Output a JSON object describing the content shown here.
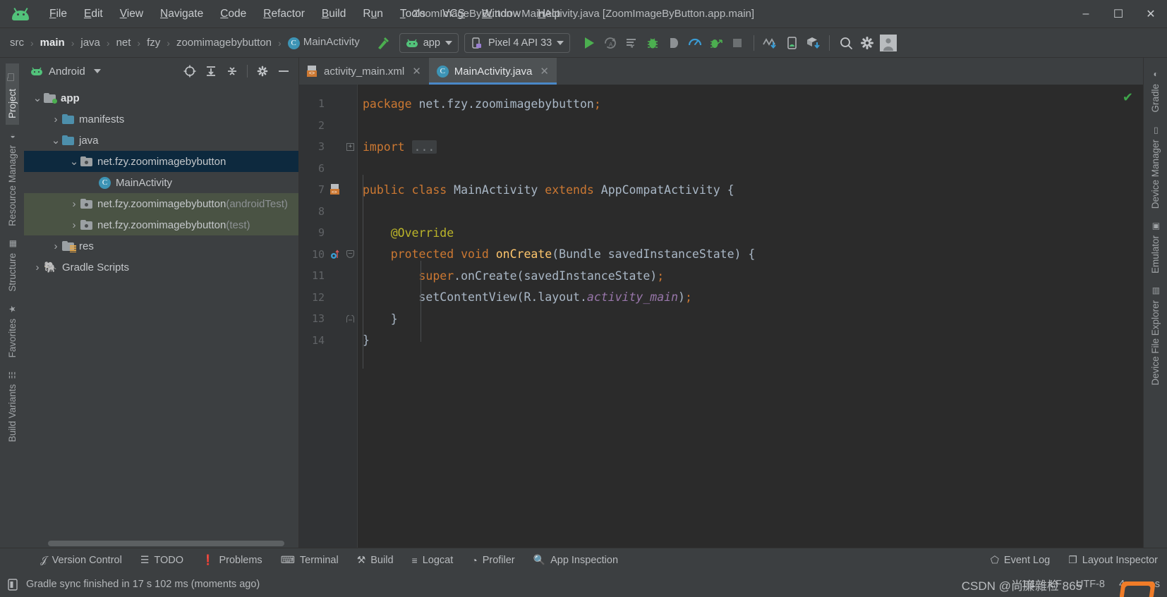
{
  "window": {
    "title": "ZoomImageByButton - MainActivity.java [ZoomImageByButton.app.main]",
    "minimize": "–",
    "maximize": "☐",
    "close": "✕"
  },
  "menubar": {
    "items": [
      {
        "label": "File",
        "mnemonic": "F"
      },
      {
        "label": "Edit",
        "mnemonic": "E"
      },
      {
        "label": "View",
        "mnemonic": "V"
      },
      {
        "label": "Navigate",
        "mnemonic": "N"
      },
      {
        "label": "Code",
        "mnemonic": "C"
      },
      {
        "label": "Refactor",
        "mnemonic": "R"
      },
      {
        "label": "Build",
        "mnemonic": "B"
      },
      {
        "label": "Run",
        "mnemonic": "u"
      },
      {
        "label": "Tools",
        "mnemonic": "T"
      },
      {
        "label": "VCS",
        "mnemonic": "S"
      },
      {
        "label": "Window",
        "mnemonic": "W"
      },
      {
        "label": "Help",
        "mnemonic": "H"
      }
    ]
  },
  "breadcrumb": {
    "separator": "›",
    "items": [
      {
        "label": "src",
        "bold": false
      },
      {
        "label": "main",
        "bold": true
      },
      {
        "label": "java",
        "bold": false
      },
      {
        "label": "net",
        "bold": false
      },
      {
        "label": "fzy",
        "bold": false
      },
      {
        "label": "zoomimagebybutton",
        "bold": false
      },
      {
        "label": "MainActivity",
        "bold": false,
        "icon": "class-icon",
        "icon_letter": "C"
      }
    ]
  },
  "toolbar": {
    "build_icon": "hammer-icon",
    "module_selector": {
      "label": "app",
      "icon": "android-icon"
    },
    "device_selector": {
      "label": "Pixel 4 API 33",
      "icon": "device-phone-icon"
    },
    "icons": [
      {
        "name": "run-icon",
        "label": "Run"
      },
      {
        "name": "rerun-coverage-icon",
        "label": "Run with Coverage"
      },
      {
        "name": "apply-changes-icon",
        "label": "Apply Changes"
      },
      {
        "name": "debug-icon",
        "label": "Debug"
      },
      {
        "name": "attach-debugger-icon",
        "label": "Attach Debugger"
      },
      {
        "name": "profiler-icon",
        "label": "Profile"
      },
      {
        "name": "debug-attach-process-icon",
        "label": "Attach to Process"
      },
      {
        "name": "stop-icon",
        "label": "Stop"
      },
      {
        "name": "sync-gradle-icon",
        "label": "Sync Project with Gradle Files"
      },
      {
        "name": "avd-manager-icon",
        "label": "Device Manager"
      },
      {
        "name": "sdk-manager-icon",
        "label": "SDK Manager"
      },
      {
        "name": "search-icon",
        "label": "Search Everywhere"
      },
      {
        "name": "gear-icon",
        "label": "Settings"
      },
      {
        "name": "avatar-icon",
        "label": "Account"
      }
    ]
  },
  "left_toolwindows": [
    {
      "label": "Project",
      "icon": "folder-icon",
      "active": true
    },
    {
      "label": "Resource Manager",
      "icon": "resource-icon",
      "active": false
    },
    {
      "label": "Structure",
      "icon": "structure-icon",
      "active": false
    },
    {
      "label": "Favorites",
      "icon": "star-icon",
      "active": false
    },
    {
      "label": "Build Variants",
      "icon": "variants-icon",
      "active": false
    }
  ],
  "right_toolwindows": [
    {
      "label": "Gradle",
      "icon": "gradle-icon"
    },
    {
      "label": "Device Manager",
      "icon": "device-manager-icon"
    },
    {
      "label": "Emulator",
      "icon": "emulator-icon"
    },
    {
      "label": "Device File Explorer",
      "icon": "device-file-explorer-icon"
    }
  ],
  "project_panel": {
    "title": "Android",
    "title_icon": "android-icon",
    "dropdown_icon": "chevron-down-icon",
    "actions": [
      {
        "name": "select-opened-file-icon",
        "label": "Select Opened File"
      },
      {
        "name": "expand-all-icon",
        "label": "Expand All"
      },
      {
        "name": "collapse-all-icon",
        "label": "Collapse All"
      },
      {
        "name": "gear-icon",
        "label": "Options"
      },
      {
        "name": "hide-icon",
        "label": "Hide"
      }
    ],
    "tree": [
      {
        "label": "app",
        "indent": 0,
        "twisty": "expanded",
        "icon": "module-folder",
        "bold": true,
        "state": "normal"
      },
      {
        "label": "manifests",
        "indent": 1,
        "twisty": "collapsed",
        "icon": "blue-folder",
        "bold": false,
        "state": "normal"
      },
      {
        "label": "java",
        "indent": 1,
        "twisty": "expanded",
        "icon": "blue-folder",
        "bold": false,
        "state": "normal"
      },
      {
        "label": "net.fzy.zoomimagebybutton",
        "indent": 2,
        "twisty": "expanded",
        "icon": "package-folder",
        "bold": false,
        "state": "selected"
      },
      {
        "label": "MainActivity",
        "indent": 3,
        "twisty": "none",
        "icon": "class-icon",
        "bold": false,
        "state": "normal"
      },
      {
        "label": "net.fzy.zoomimagebybutton",
        "suffix": " (androidTest)",
        "indent": 2,
        "twisty": "collapsed",
        "icon": "package-folder",
        "bold": false,
        "state": "tinted"
      },
      {
        "label": "net.fzy.zoomimagebybutton",
        "suffix": " (test)",
        "indent": 2,
        "twisty": "collapsed",
        "icon": "package-folder",
        "bold": false,
        "state": "tinted"
      },
      {
        "label": "res",
        "indent": 1,
        "twisty": "collapsed",
        "icon": "res-folder",
        "bold": false,
        "state": "normal"
      },
      {
        "label": "Gradle Scripts",
        "indent": 0,
        "twisty": "collapsed",
        "icon": "gradle-elephant",
        "bold": false,
        "state": "normal"
      }
    ]
  },
  "editor": {
    "tabs": [
      {
        "label": "activity_main.xml",
        "icon": "xml-layout-icon",
        "active": false,
        "closable": true
      },
      {
        "label": "MainActivity.java",
        "icon": "class-icon",
        "active": true,
        "closable": true
      }
    ],
    "inspection_status": "✔",
    "lines": [
      {
        "num": "1",
        "gutter": "",
        "tokens": [
          {
            "t": "package ",
            "c": "kw"
          },
          {
            "t": "net.fzy.zoomimagebybutton",
            "c": "id"
          },
          {
            "t": ";",
            "c": "kw"
          }
        ]
      },
      {
        "num": "2",
        "gutter": "",
        "tokens": []
      },
      {
        "num": "3",
        "gutter": "",
        "fold": "plus",
        "tokens": [
          {
            "t": "import ",
            "c": "kw"
          },
          {
            "t": "...",
            "c": "ellipsis"
          }
        ]
      },
      {
        "num": "6",
        "gutter": "",
        "tokens": []
      },
      {
        "num": "7",
        "gutter": "class-marker",
        "tokens": [
          {
            "t": "public ",
            "c": "kw"
          },
          {
            "t": "class ",
            "c": "kw"
          },
          {
            "t": "MainActivity ",
            "c": "id"
          },
          {
            "t": "extends ",
            "c": "kw"
          },
          {
            "t": "AppCompatActivity ",
            "c": "id"
          },
          {
            "t": "{",
            "c": "pun"
          }
        ]
      },
      {
        "num": "8",
        "gutter": "",
        "tokens": []
      },
      {
        "num": "9",
        "gutter": "",
        "tokens": [
          {
            "t": "    @Override",
            "c": "ann"
          }
        ]
      },
      {
        "num": "10",
        "gutter": "override-marker",
        "fold": "minus",
        "tokens": [
          {
            "t": "    protected ",
            "c": "kw"
          },
          {
            "t": "void ",
            "c": "kw"
          },
          {
            "t": "onCreate",
            "c": "mth"
          },
          {
            "t": "(Bundle savedInstanceState) {",
            "c": "id"
          }
        ]
      },
      {
        "num": "11",
        "gutter": "",
        "tokens": [
          {
            "t": "        ",
            "c": "id"
          },
          {
            "t": "super",
            "c": "kw"
          },
          {
            "t": ".onCreate(savedInstanceState)",
            "c": "id"
          },
          {
            "t": ";",
            "c": "kw"
          }
        ]
      },
      {
        "num": "12",
        "gutter": "",
        "tokens": [
          {
            "t": "        setContentView(R.layout.",
            "c": "id"
          },
          {
            "t": "activity_main",
            "c": "fld"
          },
          {
            "t": ")",
            "c": "id"
          },
          {
            "t": ";",
            "c": "kw"
          }
        ]
      },
      {
        "num": "13",
        "gutter": "",
        "fold": "end",
        "tokens": [
          {
            "t": "    }",
            "c": "pun"
          }
        ]
      },
      {
        "num": "14",
        "gutter": "",
        "tokens": [
          {
            "t": "}",
            "c": "pun"
          }
        ]
      }
    ]
  },
  "bottom_bar": {
    "left_items": [
      {
        "label": "Version Control",
        "icon": "branch-icon"
      },
      {
        "label": "TODO",
        "icon": "todo-list-icon"
      },
      {
        "label": "Problems",
        "icon": "problems-icon"
      },
      {
        "label": "Terminal",
        "icon": "terminal-icon"
      },
      {
        "label": "Build",
        "icon": "hammer-icon"
      },
      {
        "label": "Logcat",
        "icon": "logcat-icon"
      },
      {
        "label": "Profiler",
        "icon": "profiler-icon"
      },
      {
        "label": "App Inspection",
        "icon": "app-inspection-icon"
      }
    ],
    "right_items": [
      {
        "label": "Event Log",
        "icon": "event-log-icon"
      },
      {
        "label": "Layout Inspector",
        "icon": "layout-inspector-icon"
      }
    ]
  },
  "status_bar": {
    "message": "Gradle sync finished in 17 s 102 ms (moments ago)",
    "message_icon": "notification-icon",
    "caret_position": "1:1",
    "line_separator": "LF",
    "encoding": "UTF-8",
    "indent": "4 spaces",
    "watermark": "CSDN @尚廉雜检 865"
  }
}
